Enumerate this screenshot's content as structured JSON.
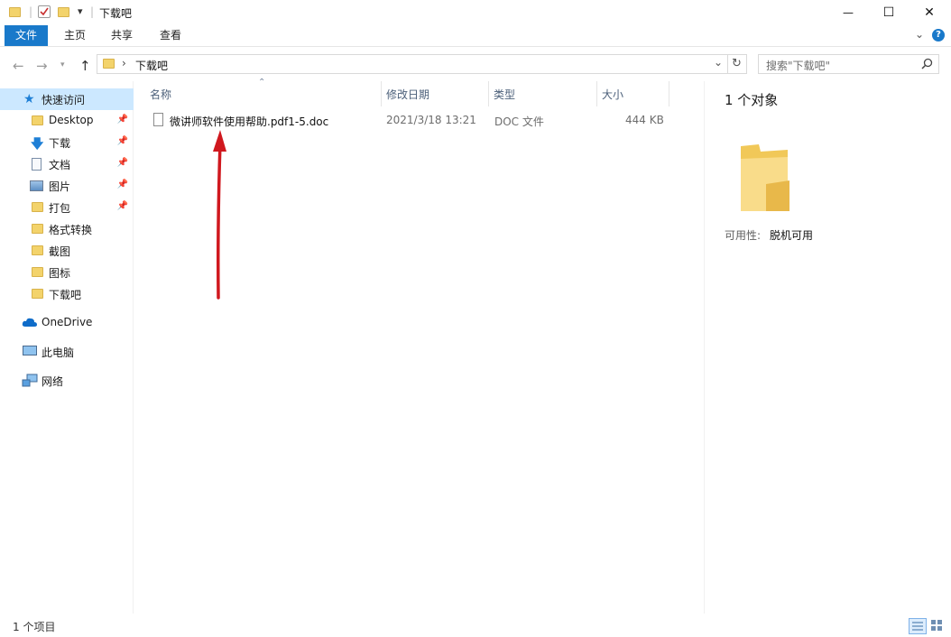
{
  "title": "下载吧",
  "qat": {
    "folder_icon": "folder-icon",
    "properties_icon": "checklist-icon",
    "dropdown": "▾"
  },
  "window_controls": {
    "minimize": "—",
    "maximize": "☐",
    "close": "✕"
  },
  "ribbon": {
    "tabs": [
      {
        "label": "文件",
        "active": true
      },
      {
        "label": "主页"
      },
      {
        "label": "共享"
      },
      {
        "label": "查看"
      }
    ],
    "collapse": "⌄",
    "help": "?"
  },
  "addressbar": {
    "crumbs": [
      "下载吧"
    ],
    "separator": "›",
    "dropdown": "⌄",
    "refresh": "↻"
  },
  "search": {
    "placeholder": "搜索\"下载吧\"",
    "icon": "search-icon"
  },
  "sidebar": {
    "quick_access": {
      "label": "快速访问"
    },
    "items": [
      {
        "label": "Desktop",
        "icon": "folder-icon",
        "pinned": true
      },
      {
        "label": "下载",
        "icon": "download-icon",
        "pinned": true
      },
      {
        "label": "文档",
        "icon": "document-icon",
        "pinned": true
      },
      {
        "label": "图片",
        "icon": "picture-icon",
        "pinned": true
      },
      {
        "label": "打包",
        "icon": "folder-icon",
        "pinned": true
      },
      {
        "label": "格式转换",
        "icon": "folder-icon"
      },
      {
        "label": "截图",
        "icon": "folder-icon"
      },
      {
        "label": "图标",
        "icon": "folder-icon"
      },
      {
        "label": "下载吧",
        "icon": "folder-icon"
      }
    ],
    "onedrive": "OneDrive",
    "this_pc": "此电脑",
    "network": "网络"
  },
  "columns": {
    "name": "名称",
    "modified": "修改日期",
    "type": "类型",
    "size": "大小"
  },
  "files": [
    {
      "name": "微讲师软件使用帮助.pdf1-5.doc",
      "modified": "2021/3/18 13:21",
      "type": "DOC 文件",
      "size": "444 KB"
    }
  ],
  "details": {
    "count": "1 个对象",
    "availability_label": "可用性:",
    "availability_value": "脱机可用"
  },
  "status": {
    "items": "1 个项目"
  },
  "colors": {
    "accent": "#1979ca",
    "selected": "#cce8ff",
    "arrow": "#d0181e"
  }
}
